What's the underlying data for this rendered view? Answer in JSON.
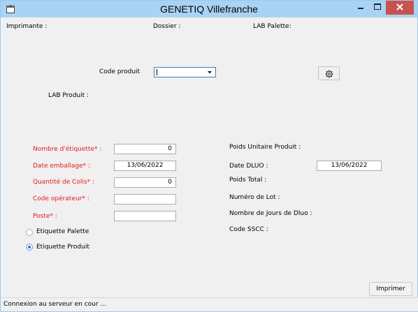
{
  "window": {
    "title": "GENETIQ Villefranche"
  },
  "header": {
    "imprimante_label": "Imprimante :",
    "dossier_label": "Dossier :",
    "lab_palette_label": "LAB Palette:"
  },
  "product": {
    "code_produit_label": "Code produit",
    "code_produit_value": "",
    "lab_produit_label": "LAB Produit :"
  },
  "form_left": {
    "nombre_etiquette": {
      "label": "Nombre d'étiquette* :",
      "value": "0"
    },
    "date_emballage": {
      "label": "Date emballage* :",
      "value": "13/06/2022"
    },
    "quantite_colis": {
      "label": "Quantité de Colis* :",
      "value": "0"
    },
    "code_operateur": {
      "label": "Code opérateur* :",
      "value": ""
    },
    "poste": {
      "label": "Poste* :",
      "value": ""
    }
  },
  "form_right": {
    "poids_unitaire": {
      "label": "Poids Unitaire Produit :"
    },
    "date_dluo": {
      "label": "Date DLUO :",
      "value": "13/06/2022"
    },
    "poids_total": {
      "label": "Poids Total :"
    },
    "numero_lot": {
      "label": "Numéro de Lot :"
    },
    "jours_dluo": {
      "label": "Nombre de Jours de Dluo :"
    },
    "code_sscc": {
      "label": "Code SSCC :"
    }
  },
  "label_type": {
    "options": [
      {
        "label": "Etiquette Palette",
        "checked": false
      },
      {
        "label": "Etiquette Produit",
        "checked": true
      }
    ]
  },
  "actions": {
    "print_label": "Imprimer"
  },
  "status": {
    "text": "Connexion au serveur en cour ..."
  },
  "colors": {
    "titlebar": "#a9d3f5",
    "required_label": "#e41b1b",
    "close_button": "#c7524f",
    "radio_accent": "#1c73c9"
  },
  "icons": {
    "app": "window-app-icon",
    "minimize": "minimize-icon",
    "maximize": "maximize-icon",
    "close": "close-icon",
    "settings": "gear-icon",
    "dropdown": "chevron-down-icon"
  }
}
